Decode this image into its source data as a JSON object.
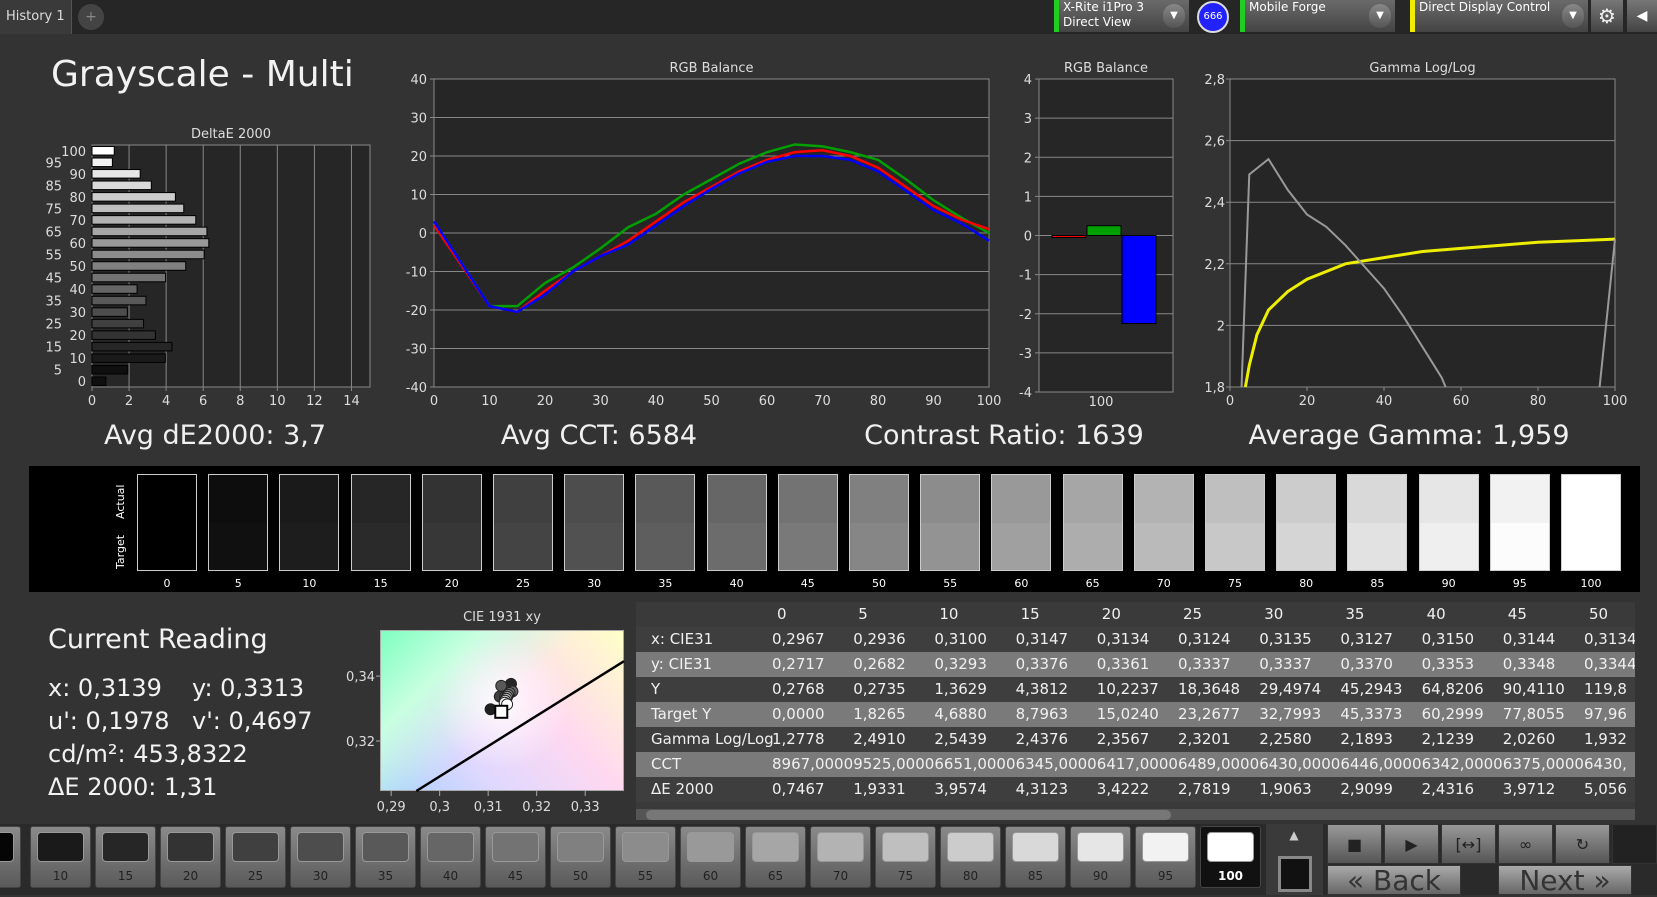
{
  "tabs": [
    {
      "label": "History 1"
    }
  ],
  "add_tab": "+",
  "toolbar": {
    "meter": {
      "line1": "X-Rite i1Pro 3",
      "line2": "Direct View",
      "status_color": "#22cc22"
    },
    "badge": "666",
    "source": {
      "label": "Mobile Forge",
      "status_color": "#22cc22"
    },
    "display": {
      "label": "Direct Display Control",
      "status_color": "#eeee00"
    },
    "settings_icon": "gear-icon",
    "collapse_icon": "chevron-left-icon"
  },
  "page_title": "Grayscale - Multi",
  "chart_data": [
    {
      "type": "bar",
      "orientation": "horizontal",
      "title": "DeltaE 2000",
      "categories": [
        0,
        5,
        10,
        15,
        20,
        25,
        30,
        35,
        40,
        45,
        50,
        55,
        60,
        65,
        70,
        75,
        80,
        85,
        90,
        95,
        100
      ],
      "values": [
        0.7467,
        1.9331,
        3.9574,
        4.3123,
        3.4222,
        2.7819,
        1.9063,
        2.9099,
        2.4316,
        3.9712,
        5.056,
        6.05,
        6.3,
        6.2,
        5.6,
        4.95,
        4.5,
        3.2,
        2.6,
        1.1,
        1.2
      ],
      "xlim": [
        0,
        15
      ],
      "xticks": [
        0,
        2,
        4,
        6,
        8,
        10,
        12,
        14
      ],
      "grid": true
    },
    {
      "type": "line",
      "title": "RGB Balance",
      "xlim": [
        0,
        100
      ],
      "ylim": [
        -40,
        40
      ],
      "xticks": [
        0,
        10,
        20,
        30,
        40,
        50,
        60,
        70,
        80,
        90,
        100
      ],
      "yticks": [
        -40,
        -30,
        -20,
        -10,
        0,
        10,
        20,
        30,
        40
      ],
      "grid": true,
      "x": [
        0,
        5,
        10,
        15,
        20,
        25,
        30,
        35,
        40,
        45,
        50,
        55,
        60,
        65,
        70,
        75,
        80,
        85,
        90,
        95,
        100
      ],
      "series": [
        {
          "color": "#00a000",
          "values": [
            2,
            -8,
            -19,
            -19,
            -13,
            -9,
            -4,
            1.5,
            5,
            10,
            14,
            18,
            21,
            23,
            22.5,
            21,
            19,
            14,
            8.5,
            4,
            0
          ]
        },
        {
          "color": "#ff0000",
          "values": [
            2,
            -8.5,
            -19,
            -20.5,
            -15,
            -10,
            -6,
            -2,
            3,
            8,
            12,
            16,
            19,
            21,
            21.5,
            20,
            17,
            12,
            7,
            3.5,
            1
          ]
        },
        {
          "color": "#0000ff",
          "values": [
            3,
            -8,
            -19,
            -20.5,
            -16,
            -10,
            -6,
            -3,
            2,
            7,
            11.5,
            15.5,
            18.5,
            20,
            20,
            19,
            16,
            11,
            6,
            2.5,
            -2
          ]
        }
      ]
    },
    {
      "type": "bar",
      "title": "RGB Balance",
      "categories": [
        "100"
      ],
      "ylim": [
        -4,
        4
      ],
      "yticks": [
        -4,
        -3,
        -2,
        -1,
        0,
        1,
        2,
        3,
        4
      ],
      "series": [
        {
          "color": "#ff0000",
          "values": [
            -0.05
          ]
        },
        {
          "color": "#00a000",
          "values": [
            0.25
          ]
        },
        {
          "color": "#0000ff",
          "values": [
            -2.25
          ]
        }
      ]
    },
    {
      "type": "line",
      "title": "Gamma Log/Log",
      "xlim": [
        0,
        100
      ],
      "ylim": [
        1.8,
        2.8
      ],
      "xticks": [
        0,
        20,
        40,
        60,
        80,
        100
      ],
      "yticks": [
        "1,8",
        "2",
        "2,2",
        "2,4",
        "2,6",
        "2,8"
      ],
      "grid": true,
      "series": [
        {
          "color": "#eeee00",
          "points": [
            [
              4,
              1.8
            ],
            [
              5,
              1.87
            ],
            [
              7,
              1.97
            ],
            [
              10,
              2.05
            ],
            [
              15,
              2.11
            ],
            [
              20,
              2.15
            ],
            [
              30,
              2.2
            ],
            [
              40,
              2.22
            ],
            [
              50,
              2.24
            ],
            [
              60,
              2.25
            ],
            [
              70,
              2.26
            ],
            [
              80,
              2.27
            ],
            [
              90,
              2.275
            ],
            [
              100,
              2.28
            ]
          ]
        },
        {
          "color": "#999999",
          "points": [
            [
              3,
              1.8
            ],
            [
              5,
              2.49
            ],
            [
              10,
              2.54
            ],
            [
              15,
              2.44
            ],
            [
              20,
              2.36
            ],
            [
              25,
              2.32
            ],
            [
              30,
              2.26
            ],
            [
              35,
              2.19
            ],
            [
              40,
              2.12
            ],
            [
              45,
              2.03
            ],
            [
              50,
              1.93
            ],
            [
              55,
              1.83
            ],
            [
              56,
              1.8
            ]
          ]
        },
        {
          "color": "#999999",
          "points": [
            [
              96,
              1.8
            ],
            [
              100,
              2.28
            ]
          ]
        }
      ]
    },
    {
      "type": "scatter",
      "title": "CIE 1931 xy",
      "xlim": [
        0.2877,
        0.338
      ],
      "ylim": [
        0.3046,
        0.3542
      ],
      "xticks": [
        "0,29",
        "0,3",
        "0,31",
        "0,32",
        "0,33"
      ],
      "yticks": [
        "0,32",
        "0,34"
      ],
      "target": [
        0.3127,
        0.329
      ],
      "points": [
        [
          0.3105,
          0.3298,
          0
        ],
        [
          0.3147,
          0.3376,
          15
        ],
        [
          0.3134,
          0.3361,
          20
        ],
        [
          0.3124,
          0.3337,
          25
        ],
        [
          0.3135,
          0.3337,
          30
        ],
        [
          0.3127,
          0.337,
          35
        ],
        [
          0.315,
          0.3353,
          40
        ],
        [
          0.3144,
          0.3348,
          45
        ],
        [
          0.3141,
          0.3342,
          55
        ],
        [
          0.3139,
          0.3336,
          65
        ],
        [
          0.3137,
          0.333,
          75
        ],
        [
          0.3135,
          0.3324,
          85
        ],
        [
          0.3134,
          0.3318,
          95
        ],
        [
          0.3139,
          0.3313,
          100
        ]
      ]
    }
  ],
  "summary": {
    "avg_de": "Avg dE2000: 3,7",
    "avg_cct": "Avg CCT: 6584",
    "contrast": "Contrast Ratio: 1639",
    "avg_gamma": "Average Gamma: 1,959"
  },
  "swatches": {
    "actual_label": "Actual",
    "target_label": "Target",
    "items": [
      "0",
      "5",
      "10",
      "15",
      "20",
      "25",
      "30",
      "35",
      "40",
      "45",
      "50",
      "55",
      "60",
      "65",
      "70",
      "75",
      "80",
      "85",
      "90",
      "95",
      "100"
    ]
  },
  "current_reading": {
    "title": "Current Reading",
    "x": "x: 0,3139",
    "y": "y: 0,3313",
    "u": "u': 0,1978",
    "v": "v': 0,4697",
    "cdm2": "cd/m²: 453,8322",
    "de": "ΔE 2000: 1,31"
  },
  "table": {
    "columns": [
      "0",
      "5",
      "10",
      "15",
      "20",
      "25",
      "30",
      "35",
      "40",
      "45",
      "50"
    ],
    "rows": [
      {
        "label": "x: CIE31",
        "values": [
          "0,2967",
          "0,2936",
          "0,3100",
          "0,3147",
          "0,3134",
          "0,3124",
          "0,3135",
          "0,3127",
          "0,3150",
          "0,3144",
          "0,3134"
        ]
      },
      {
        "label": "y: CIE31",
        "values": [
          "0,2717",
          "0,2682",
          "0,3293",
          "0,3376",
          "0,3361",
          "0,3337",
          "0,3337",
          "0,3370",
          "0,3353",
          "0,3348",
          "0,3344"
        ]
      },
      {
        "label": "Y",
        "values": [
          "0,2768",
          "0,2735",
          "1,3629",
          "4,3812",
          "10,2237",
          "18,3648",
          "29,4974",
          "45,2943",
          "64,8206",
          "90,4110",
          "119,8"
        ]
      },
      {
        "label": "Target Y",
        "values": [
          "0,0000",
          "1,8265",
          "4,6880",
          "8,7963",
          "15,0240",
          "23,2677",
          "32,7993",
          "45,3373",
          "60,2999",
          "77,8055",
          "97,96"
        ]
      },
      {
        "label": "Gamma Log/Log",
        "values": [
          "1,2778",
          "2,4910",
          "2,5439",
          "2,4376",
          "2,3567",
          "2,3201",
          "2,2580",
          "2,1893",
          "2,1239",
          "2,0260",
          "1,932"
        ]
      },
      {
        "label": "CCT",
        "values": [
          "8967,0000",
          "9525,0000",
          "6651,0000",
          "6345,0000",
          "6417,0000",
          "6489,0000",
          "6430,0000",
          "6446,0000",
          "6342,0000",
          "6375,0000",
          "6430,"
        ]
      },
      {
        "label": "ΔE 2000",
        "values": [
          "0,7467",
          "1,9331",
          "3,9574",
          "4,3123",
          "3,4222",
          "2,7819",
          "1,9063",
          "2,9099",
          "2,4316",
          "3,9712",
          "5,056"
        ]
      }
    ]
  },
  "patches": {
    "items": [
      "10",
      "15",
      "20",
      "25",
      "30",
      "35",
      "40",
      "45",
      "50",
      "55",
      "60",
      "65",
      "70",
      "75",
      "80",
      "85",
      "90",
      "95",
      "100"
    ],
    "selected": "100"
  },
  "nav": {
    "back": "Back",
    "next": "Next",
    "back_icon": "«",
    "next_icon": "»"
  },
  "controls": [
    {
      "icon": "stop-icon",
      "glyph": "■"
    },
    {
      "icon": "play-icon",
      "glyph": "▶"
    },
    {
      "icon": "read-range-icon",
      "glyph": "[↔]"
    },
    {
      "icon": "continuous-icon",
      "glyph": "∞"
    },
    {
      "icon": "refresh-icon",
      "glyph": "↻"
    }
  ]
}
